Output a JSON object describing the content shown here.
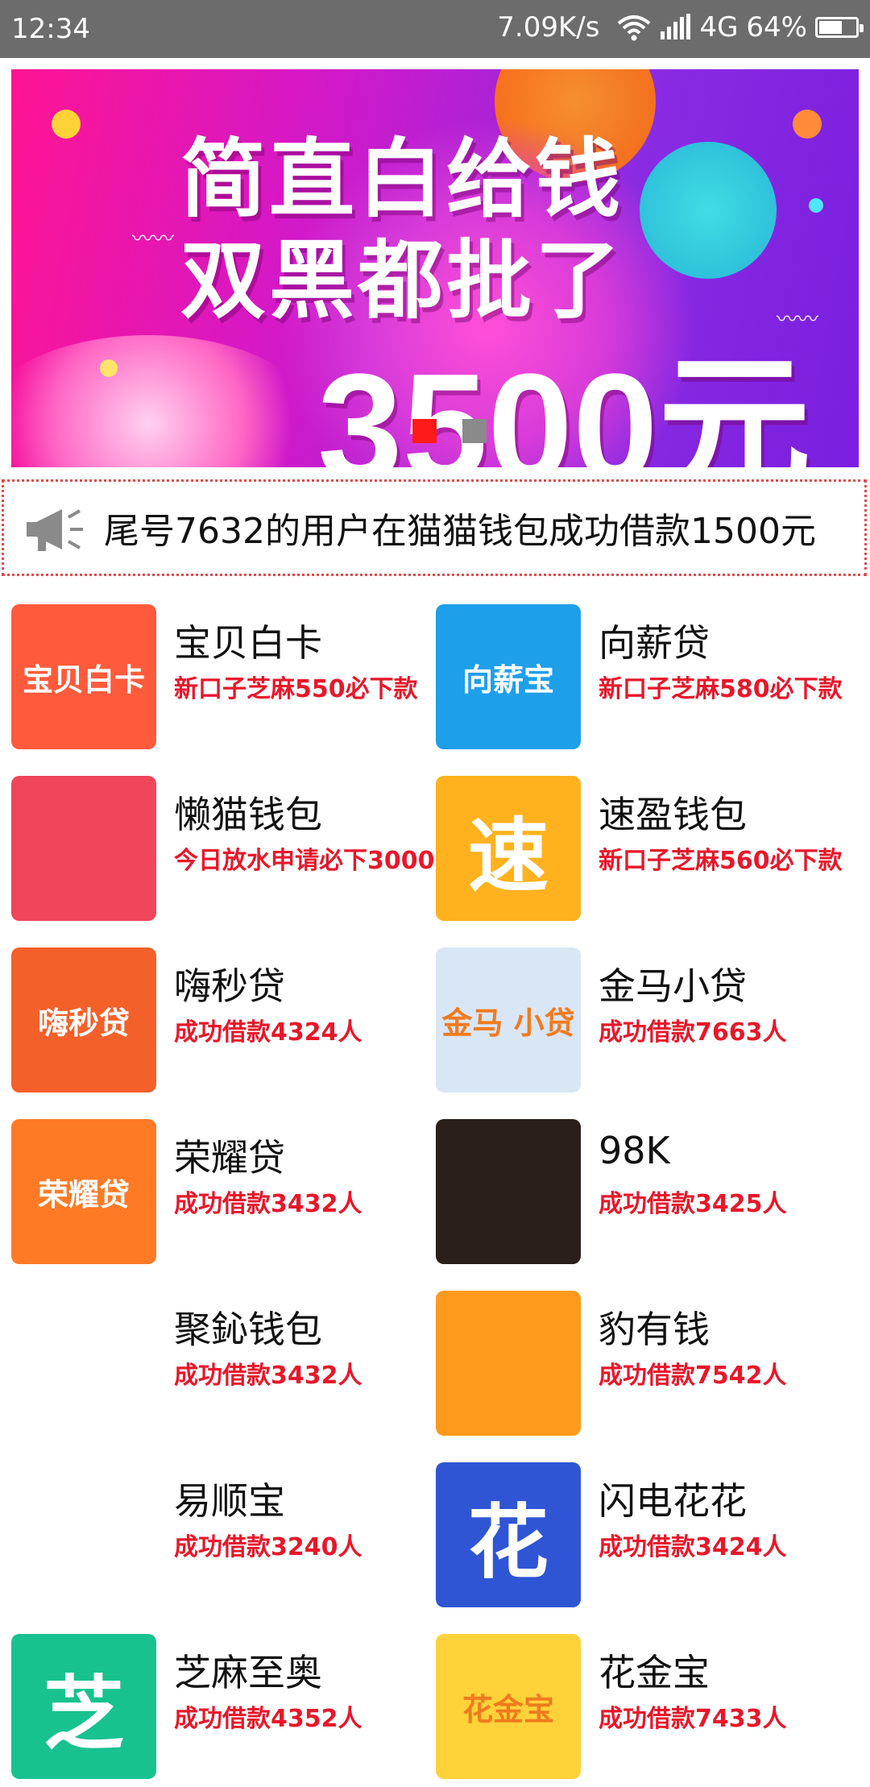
{
  "status_bar": {
    "time": "12:34",
    "net_speed": "7.09K/s",
    "network": "4G",
    "battery": "64%",
    "battery_level": 0.64
  },
  "banner": {
    "line1": "简直白给钱",
    "line2": "双黑都批了",
    "line3": "3500元",
    "slide_index": 1,
    "slide_count": 2
  },
  "notice": {
    "text": "尾号7632的用户在猫猫钱包成功借款1500元"
  },
  "apps": [
    {
      "name": "宝贝白卡",
      "desc": "新口子芝麻550必下款",
      "logo_text": "宝贝白卡",
      "color": "#ff5a3c"
    },
    {
      "name": "向薪贷",
      "desc": "新口子芝麻580必下款",
      "logo_text": "向薪宝",
      "color": "#1e9fea"
    },
    {
      "name": "懒猫钱包",
      "desc": "今日放水申请必下3000",
      "logo_text": "",
      "color": "#f0455a"
    },
    {
      "name": "速盈钱包",
      "desc": "新口子芝麻560必下款",
      "logo_text": "速",
      "color": "#ffb21e"
    },
    {
      "name": "嗨秒贷",
      "desc": "成功借款4324人",
      "logo_text": "嗨秒贷",
      "color": "#f4602a"
    },
    {
      "name": "金马小贷",
      "desc": "成功借款7663人",
      "logo_text": "金马 小贷",
      "color": "#d9e6f5"
    },
    {
      "name": "荣耀贷",
      "desc": "成功借款3432人",
      "logo_text": "荣耀贷",
      "color": "#ff7a25"
    },
    {
      "name": "98K",
      "desc": "成功借款3425人",
      "logo_text": "",
      "color": "#2a1f1a"
    },
    {
      "name": "聚鈊钱包",
      "desc": "成功借款3432人",
      "logo_text": "",
      "color": "#ffffff"
    },
    {
      "name": "豹有钱",
      "desc": "成功借款7542人",
      "logo_text": "",
      "color": "#ff9a1c"
    },
    {
      "name": "易顺宝",
      "desc": "成功借款3240人",
      "logo_text": "",
      "color": "#ffffff"
    },
    {
      "name": "闪电花花",
      "desc": "成功借款3424人",
      "logo_text": "花",
      "color": "#2f55d4"
    },
    {
      "name": "芝麻至奥",
      "desc": "成功借款4352人",
      "logo_text": "芝",
      "color": "#17c28f"
    },
    {
      "name": "花金宝",
      "desc": "成功借款7433人",
      "logo_text": "花金宝",
      "color": "#ffd23a"
    }
  ]
}
